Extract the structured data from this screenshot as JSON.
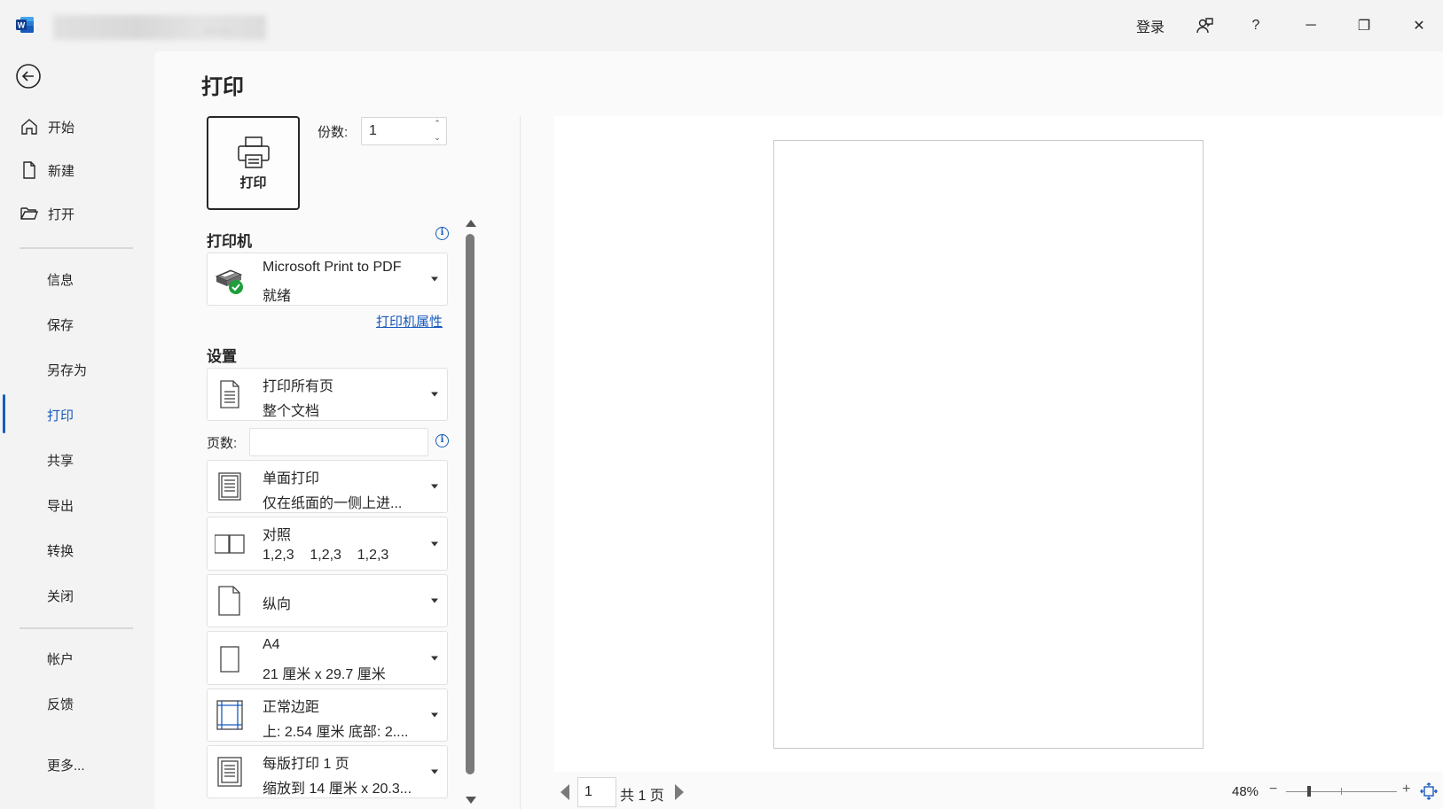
{
  "titlebar": {
    "doc_title": "...  .  ..",
    "login": "登录",
    "feedback_icon": "feedback-icon",
    "help": "?",
    "minimize": "─",
    "restore": "❐",
    "close": "✕"
  },
  "nav": {
    "top_items": [
      {
        "label": "开始",
        "icon": "home-icon"
      },
      {
        "label": "新建",
        "icon": "new-doc-icon"
      },
      {
        "label": "打开",
        "icon": "folder-open-icon"
      }
    ],
    "mid_items": [
      "信息",
      "保存",
      "另存为",
      "打印",
      "共享",
      "导出",
      "转换",
      "关闭"
    ],
    "bottom_items": [
      "帐户",
      "反馈",
      "更多..."
    ],
    "active": "打印"
  },
  "print": {
    "title": "打印",
    "print_button": "打印",
    "copies_label": "份数:",
    "copies_value": "1",
    "printer_heading": "打印机",
    "printer_name": "Microsoft Print to PDF",
    "printer_status": "就绪",
    "printer_properties": "打印机属性",
    "settings_heading": "设置",
    "pages_label": "页数:",
    "pages_value": "",
    "settings": {
      "range": {
        "line1": "打印所有页",
        "line2": "整个文档"
      },
      "sides": {
        "line1": "单面打印",
        "line2": "仅在纸面的一侧上进..."
      },
      "collate": {
        "line1": "对照",
        "line2": "1,2,3    1,2,3    1,2,3"
      },
      "orientation": {
        "line1": "纵向"
      },
      "paper": {
        "line1": "A4",
        "line2": "21 厘米 x 29.7 厘米"
      },
      "margins": {
        "line1": "正常边距",
        "line2": "上: 2.54 厘米 底部: 2...."
      },
      "per_sheet": {
        "line1": "每版打印 1 页",
        "line2": "缩放到 14 厘米 x 20.3..."
      }
    }
  },
  "preview": {
    "page_input": "1",
    "page_total": "共 1 页",
    "zoom": "48%",
    "zoom_value": 0.48,
    "zoom_minus": "−",
    "zoom_plus": "+"
  },
  "colors": {
    "accent": "#185abd",
    "background": "#f3f3f3",
    "panel": "#fafafa",
    "printer_ok": "#1e9e3c"
  }
}
